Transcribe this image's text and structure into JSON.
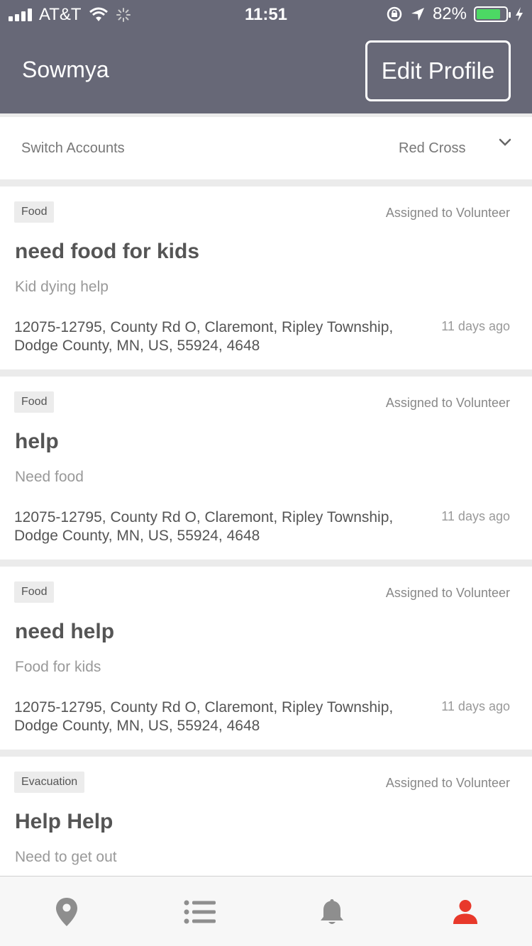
{
  "status_bar": {
    "carrier": "AT&T",
    "time": "11:51",
    "battery_percent": "82%",
    "battery_level": 0.82
  },
  "header": {
    "title": "Sowmya",
    "edit_button": "Edit Profile"
  },
  "switch_accounts": {
    "label": "Switch Accounts",
    "selected": "Red Cross"
  },
  "requests": [
    {
      "category": "Food",
      "status": "Assigned to Volunteer",
      "title": "need food for kids",
      "description": "Kid dying help",
      "address": "12075-12795, County Rd O, Claremont, Ripley Township, Dodge County, MN, US, 55924, 4648",
      "time": "11 days ago"
    },
    {
      "category": "Food",
      "status": "Assigned to Volunteer",
      "title": "help",
      "description": "Need food",
      "address": "12075-12795, County Rd O, Claremont, Ripley Township, Dodge County, MN, US, 55924, 4648",
      "time": "11 days ago"
    },
    {
      "category": "Food",
      "status": "Assigned to Volunteer",
      "title": "need help",
      "description": "Food for kids",
      "address": "12075-12795, County Rd O, Claremont, Ripley Township, Dodge County, MN, US, 55924, 4648",
      "time": "11 days ago"
    },
    {
      "category": "Evacuation",
      "status": "Assigned to Volunteer",
      "title": "Help Help",
      "description": "Need to get out"
    }
  ],
  "tab_bar": {
    "tabs": [
      "map-pin-icon",
      "list-icon",
      "bell-icon",
      "person-icon"
    ],
    "active_tab": "person-icon"
  },
  "colors": {
    "header_bg": "#676877",
    "accent_active": "#e8392b",
    "tab_inactive": "#8e8e8e",
    "battery_fill": "#4cd964"
  }
}
